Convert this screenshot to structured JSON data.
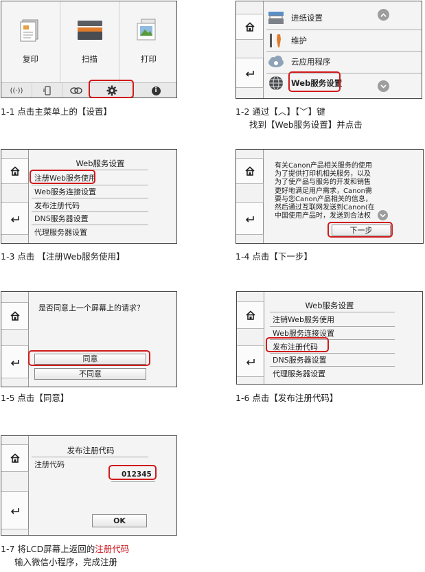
{
  "step1": {
    "tiles": [
      {
        "label": "复印",
        "icon": "copy-icon"
      },
      {
        "label": "扫描",
        "icon": "scan-icon"
      },
      {
        "label": "打印",
        "icon": "print-icon"
      }
    ],
    "bottom_bar": [
      {
        "label": "((·))",
        "icon": "wireless-icon"
      },
      {
        "label": "",
        "icon": "phone-icon"
      },
      {
        "label": "",
        "icon": "link-icon"
      },
      {
        "label": "",
        "icon": "gear-icon"
      },
      {
        "label": "i",
        "icon": "info-icon"
      }
    ],
    "caption": "1-1 点击主菜单上的【设置】"
  },
  "step2": {
    "items": [
      {
        "label": "进纸设置",
        "icon": "paper-feed-icon"
      },
      {
        "label": "维护",
        "icon": "maintenance-icon"
      },
      {
        "label": "云应用程序",
        "icon": "cloud-icon"
      },
      {
        "label": "Web服务设置",
        "icon": "globe-icon"
      }
    ],
    "caption_line1": "1-2 通过【︿】【﹀】键",
    "caption_line2": "找到【Web服务设置】并点击"
  },
  "step3": {
    "title": "Web服务设置",
    "items": [
      "注册Web服务使用",
      "Web服务连接设置",
      "发布注册代码",
      "DNS服务器设置",
      "代理服务器设置"
    ],
    "caption": "1-3 点击 【注册Web服务使用】"
  },
  "step4": {
    "lines": [
      "有关Canon产品相关服务的使用",
      "为了提供打印机相关服务，以及",
      "为了使产品与服务的开发和销售",
      "更好地满足用户需求，Canon需",
      "要与您Canon产品相关的信息，",
      "然后通过互联网发送到Canon(在",
      "中国使用产品时，发送到合法权"
    ],
    "next_button": "下一步",
    "caption": "1-4 点击【下一步】"
  },
  "step5": {
    "question": "是否同意上一个屏幕上的请求？",
    "agree": "同意",
    "disagree": "不同意",
    "caption": "1-5 点击【同意】"
  },
  "step6": {
    "title": "Web服务设置",
    "items": [
      "注销Web服务使用",
      "Web服务连接设置",
      "发布注册代码",
      "DNS服务器设置",
      "代理服务器设置"
    ],
    "caption": "1-6 点击【发布注册代码】"
  },
  "step7": {
    "title": "发布注册代码",
    "field_label": "注册代码",
    "code": "012345",
    "ok": "OK",
    "caption_prefix": "1-7 将LCD屏幕上返回的",
    "caption_highlight": "注册代码",
    "caption_line2": "输入微信小程序，完成注册"
  },
  "colors": {
    "highlight": "#d11a1a",
    "panel_bg": "#f4f4f4"
  }
}
